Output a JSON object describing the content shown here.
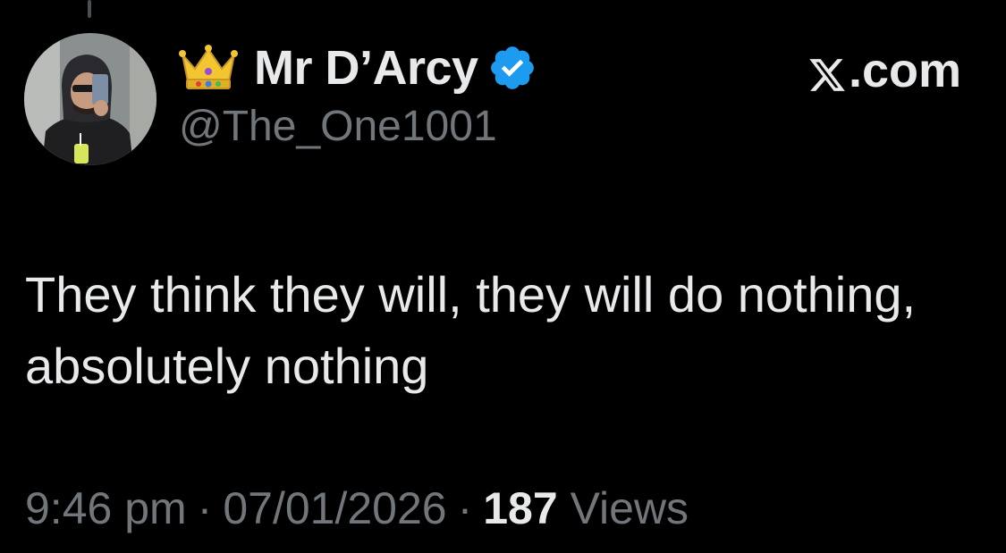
{
  "author": {
    "display_name": "Mr D’Arcy",
    "handle": "@The_One1001",
    "verified": true,
    "badge_icon": "crown-emoji-icon",
    "verified_color": "#1d9bf0"
  },
  "brand": {
    "label": ".com",
    "logo_icon": "x-logo-icon"
  },
  "tweet": {
    "text": "They think they will, they will do nothing, absolutely nothing"
  },
  "meta": {
    "time": "9:46 pm",
    "separator": "·",
    "date": "07/01/2026",
    "views_count": "187",
    "views_label": "Views"
  },
  "colors": {
    "background": "#000000",
    "primary_text": "#e7e9ea",
    "secondary_text": "#71767b"
  }
}
